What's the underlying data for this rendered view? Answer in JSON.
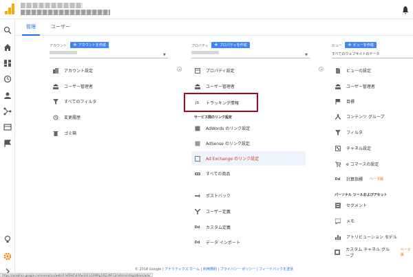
{
  "tabs": {
    "admin": "管理",
    "users": "ユーザー"
  },
  "account": {
    "header": "アカウント",
    "create": "アカウントを作成",
    "items": [
      {
        "label": "アカウント設定",
        "icon": "building-icon"
      },
      {
        "label": "ユーザー管理者",
        "icon": "users-icon"
      },
      {
        "label": "すべてのフィルタ",
        "icon": "filter-icon"
      },
      {
        "label": "変更履歴",
        "icon": "history-icon"
      },
      {
        "label": "ゴミ箱",
        "icon": "trash-icon"
      }
    ]
  },
  "property": {
    "header": "プロパティ",
    "create": "プロパティを作成",
    "items": [
      {
        "label": "プロパティ設定",
        "icon": "settings-square-icon"
      },
      {
        "label": "ユーザー管理者",
        "icon": "users-icon"
      },
      {
        "label": "トラッキング情報",
        "icon": "js-icon"
      }
    ],
    "section": "サービス間のリンク設定",
    "links": [
      {
        "label": "AdWords のリンク設定",
        "icon": "adwords-icon"
      },
      {
        "label": "AdSense のリンク設定",
        "icon": "adsense-icon"
      },
      {
        "label": "Ad Exchange のリンク設定",
        "icon": "adexchange-icon"
      },
      {
        "label": "すべての商品",
        "icon": "products-icon"
      }
    ],
    "extra": [
      {
        "label": "ポストバック",
        "icon": "postback-icon"
      },
      {
        "label": "ユーザー定義",
        "icon": "user-defined-icon"
      },
      {
        "label": "カスタム定義",
        "icon": "dd-icon"
      },
      {
        "label": "データ インポート",
        "icon": "dd-import-icon"
      }
    ]
  },
  "view": {
    "header": "ビュー",
    "create": "ビューを作成",
    "selected": "すべてのウェブサイトのデータ",
    "items": [
      {
        "label": "ビューの設定",
        "icon": "doc-icon"
      },
      {
        "label": "ユーザー管理者",
        "icon": "users-icon"
      },
      {
        "label": "目標",
        "icon": "flag-icon"
      },
      {
        "label": "コンテンツ グループ",
        "icon": "content-group-icon"
      },
      {
        "label": "フィルタ",
        "icon": "filter-icon"
      },
      {
        "label": "チャネル設定",
        "icon": "channel-icon"
      },
      {
        "label": "e コマースの設定",
        "icon": "cart-icon"
      },
      {
        "label": "計算指標",
        "icon": "dd-icon",
        "badge": "ベータ版"
      }
    ],
    "section": "パーソナル ツールおよびアセット",
    "tools": [
      {
        "label": "セグメント",
        "icon": "segment-icon"
      },
      {
        "label": "メモ",
        "icon": "memo-icon"
      },
      {
        "label": "アトリビューション モデル",
        "icon": "attribution-icon"
      },
      {
        "label": "カスタム チャネル グループ",
        "icon": "custom-channel-icon",
        "badge": "ベータ版"
      }
    ]
  },
  "footer": {
    "copyright": "© 2018 Google",
    "links": [
      "アナリティクス ホーム",
      "利用規約",
      "プライバシー ポリシー",
      "フィードバックを送信"
    ]
  },
  "status_url": "https://analytics.google.com/analytics/web/#/a85845404w102143908p106149112/admin/integrations/adx/",
  "colors": {
    "accent": "#4285f4",
    "highlight_box": "#b00020",
    "orange": "#f9ab00"
  }
}
